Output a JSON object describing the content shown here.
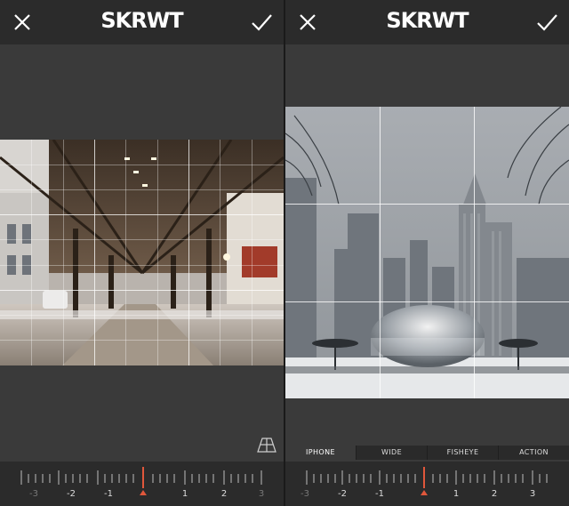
{
  "app": {
    "title": "SKRWT"
  },
  "screens": [
    {
      "title": "SKRWT",
      "ruler_labels": [
        "-3",
        "-2",
        "-1",
        "1",
        "2",
        "3"
      ]
    },
    {
      "title": "SKRWT",
      "lens_tabs": [
        {
          "label": "IPHONE",
          "active": true
        },
        {
          "label": "WIDE",
          "active": false
        },
        {
          "label": "FISHEYE",
          "active": false
        },
        {
          "label": "ACTION",
          "active": false
        }
      ],
      "ruler_labels": [
        "-3",
        "-2",
        "-1",
        "1",
        "2",
        "3"
      ]
    }
  ],
  "icons": {
    "close": "close-icon",
    "done": "checkmark-icon",
    "perspective": "perspective-grid-icon",
    "indicator": "ruler-indicator-icon"
  },
  "colors": {
    "accent": "#e0573b",
    "panel": "#3a3a3a",
    "bar": "#2b2b2b"
  }
}
